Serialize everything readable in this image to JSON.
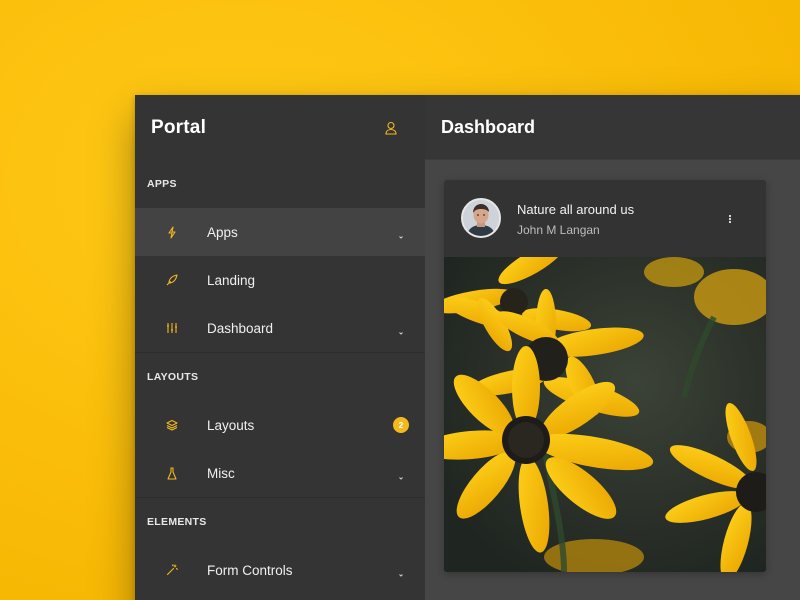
{
  "sidebar": {
    "brand": "Portal",
    "sections": [
      {
        "label": "APPS"
      },
      {
        "label": "LAYOUTS"
      },
      {
        "label": "ELEMENTS"
      }
    ],
    "items": [
      {
        "label": "Apps",
        "icon": "lightning-icon",
        "active": true,
        "has_chevron": true
      },
      {
        "label": "Landing",
        "icon": "rocket-icon",
        "has_chevron": false
      },
      {
        "label": "Dashboard",
        "icon": "sliders-icon",
        "has_chevron": true
      },
      {
        "label": "Layouts",
        "icon": "layers-icon",
        "badge": "2"
      },
      {
        "label": "Misc",
        "icon": "flask-icon",
        "has_chevron": true
      },
      {
        "label": "Form Controls",
        "icon": "magic-wand-icon",
        "has_chevron": true
      }
    ]
  },
  "header": {
    "title": "Dashboard"
  },
  "card": {
    "title": "Nature all around us",
    "author": "John M Langan"
  },
  "colors": {
    "accent": "#f5b81c",
    "background": "#fec40f",
    "sidebar": "#343434",
    "content": "#464646"
  }
}
